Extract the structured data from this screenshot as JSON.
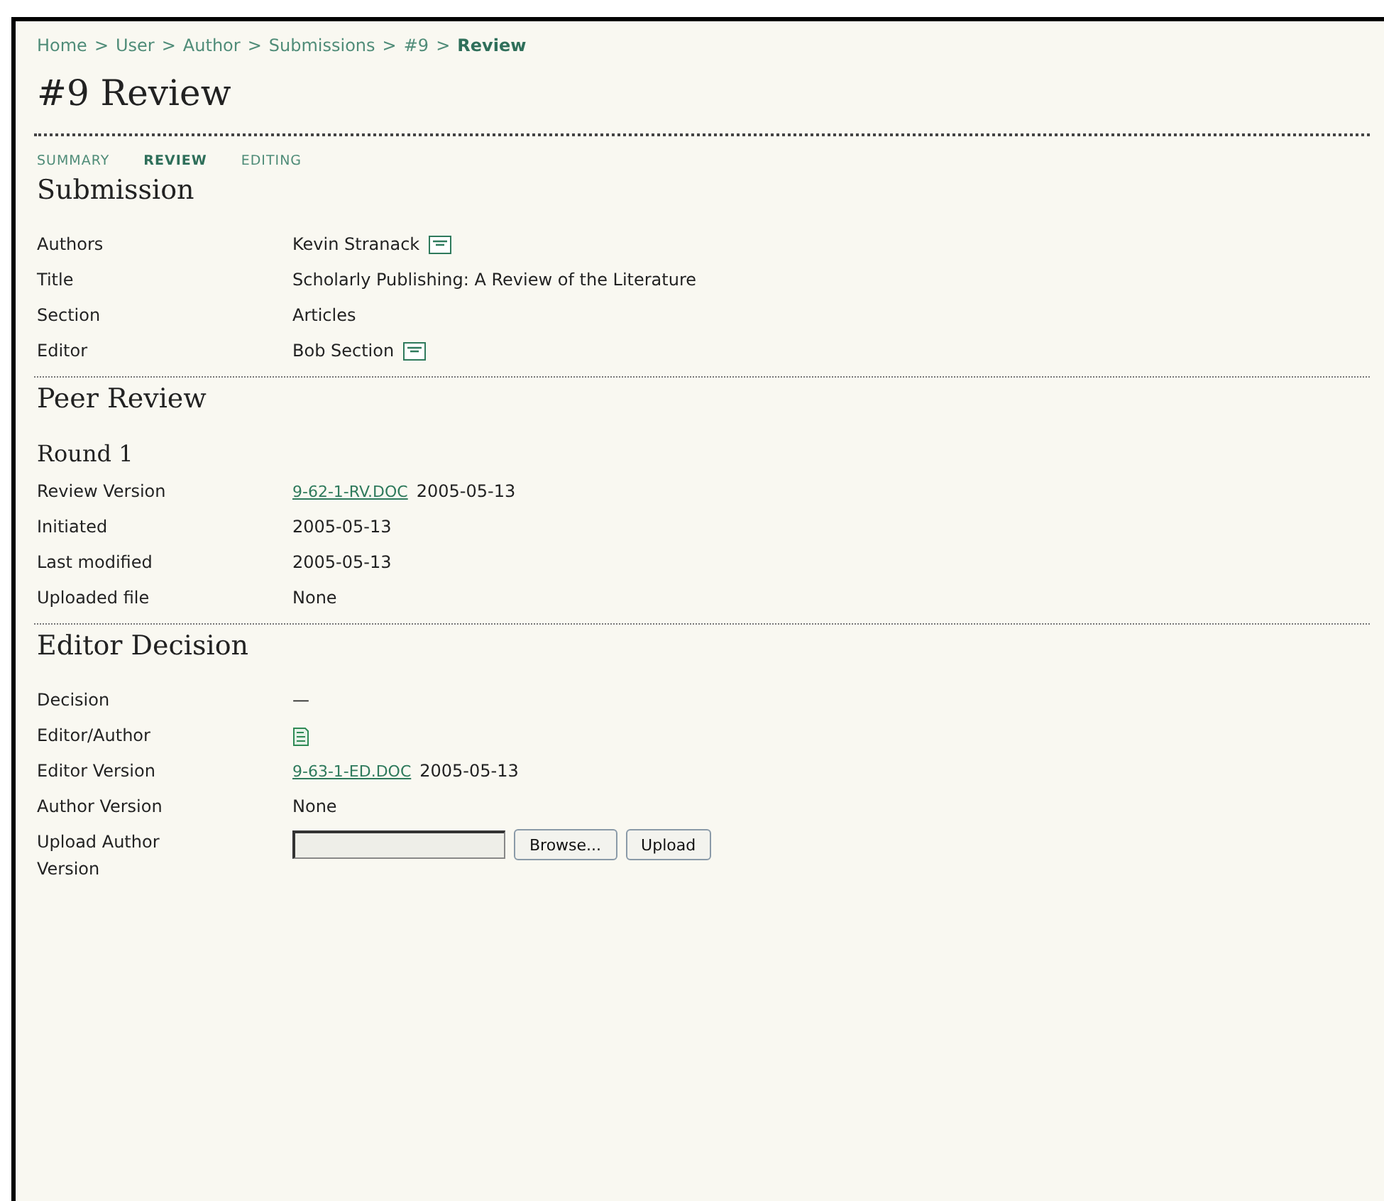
{
  "breadcrumb": [
    {
      "label": "Home",
      "current": false
    },
    {
      "label": "User",
      "current": false
    },
    {
      "label": "Author",
      "current": false
    },
    {
      "label": "Submissions",
      "current": false
    },
    {
      "label": "#9",
      "current": false
    },
    {
      "label": "Review",
      "current": true
    }
  ],
  "breadcrumb_separator": ">",
  "page_title": "#9 Review",
  "tabs": [
    {
      "label": "SUMMARY",
      "selected": false
    },
    {
      "label": "REVIEW",
      "selected": true
    },
    {
      "label": "EDITING",
      "selected": false
    }
  ],
  "sections": [
    {
      "heading": "Submission",
      "rows": [
        {
          "label": "Authors",
          "value": [
            {
              "kind": "text",
              "text": "Kevin Stranack"
            },
            {
              "kind": "mail"
            }
          ]
        },
        {
          "label": "Title",
          "value": [
            {
              "kind": "text",
              "text": "Scholarly Publishing: A Review of the Literature"
            }
          ]
        },
        {
          "label": "Section",
          "value": [
            {
              "kind": "text",
              "text": "Articles"
            }
          ]
        },
        {
          "label": "Editor",
          "value": [
            {
              "kind": "text",
              "text": "Bob Section"
            },
            {
              "kind": "mail"
            }
          ]
        }
      ]
    },
    {
      "heading": "Peer Review",
      "subheading": "Round 1",
      "rows": [
        {
          "label": "Review Version",
          "value": [
            {
              "kind": "link",
              "text": "9-62-1-RV.DOC"
            },
            {
              "kind": "text",
              "text": "2005-05-13"
            }
          ]
        },
        {
          "label": "Initiated",
          "value": [
            {
              "kind": "text",
              "text": "2005-05-13"
            }
          ]
        },
        {
          "label": "Last modified",
          "value": [
            {
              "kind": "text",
              "text": "2005-05-13"
            }
          ]
        },
        {
          "label": "Uploaded file",
          "value": [
            {
              "kind": "text",
              "text": "None"
            }
          ]
        }
      ]
    },
    {
      "heading": "Editor Decision",
      "rows": [
        {
          "label": "Decision",
          "value": [
            {
              "kind": "text",
              "text": "—"
            }
          ]
        },
        {
          "label": "Editor/Author",
          "value": [
            {
              "kind": "note"
            }
          ]
        },
        {
          "label": "Editor Version",
          "value": [
            {
              "kind": "link",
              "text": "9-63-1-ED.DOC"
            },
            {
              "kind": "text",
              "text": "2005-05-13"
            }
          ]
        },
        {
          "label": "Author Version",
          "value": [
            {
              "kind": "text",
              "text": "None"
            }
          ]
        },
        {
          "label": "Upload Author Version",
          "value": [
            {
              "kind": "file"
            },
            {
              "kind": "button",
              "text": "Browse..."
            },
            {
              "kind": "button",
              "text": "Upload"
            }
          ]
        }
      ]
    }
  ]
}
